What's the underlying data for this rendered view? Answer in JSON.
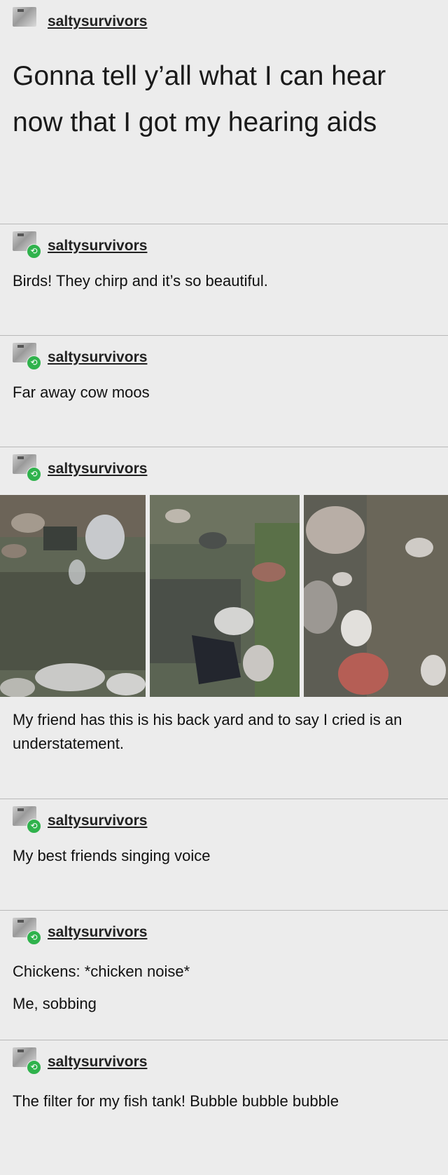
{
  "posts": [
    {
      "username": "saltysurvivors",
      "text": "Gonna tell y’all what I can hear now that I got my hearing aids"
    },
    {
      "username": "saltysurvivors",
      "text": "Birds! They chirp and it’s so beautiful."
    },
    {
      "username": "saltysurvivors",
      "text": "Far away cow moos"
    },
    {
      "username": "saltysurvivors",
      "text": "My friend has this is his back yard and to say I cried is an understatement."
    },
    {
      "username": "saltysurvivors",
      "text": "My best friends singing voice"
    },
    {
      "username": "saltysurvivors",
      "text": "Chickens: *chicken noise*",
      "text2": "Me, sobbing"
    },
    {
      "username": "saltysurvivors",
      "text": "The filter for my fish tank! Bubble bubble bubble"
    }
  ],
  "icons": {
    "avatar": "avatar-icon",
    "reblog": "reblog-icon"
  },
  "colors": {
    "background": "#ececec",
    "reblog": "#2fb24c",
    "divider": "#b9b9b9"
  }
}
